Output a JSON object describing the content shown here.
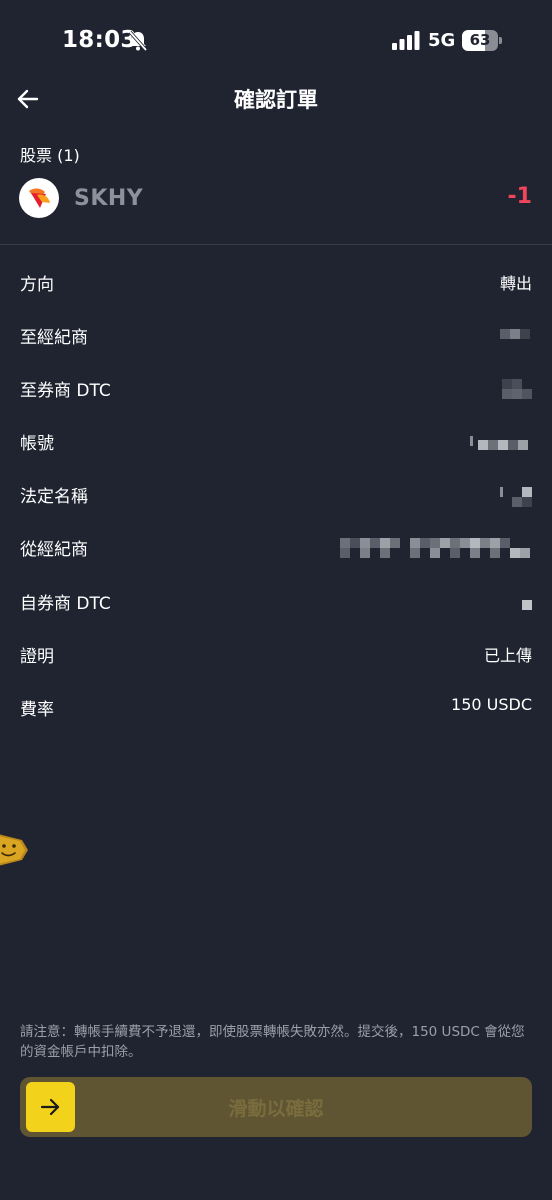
{
  "status_bar": {
    "time": "18:03",
    "network": "5G",
    "battery_percent": "63",
    "battery_level": 0.63
  },
  "header": {
    "title": "確認訂單"
  },
  "stocks": {
    "label": "股票 (1)",
    "items": [
      {
        "ticker": "SKHY",
        "quantity": "-1"
      }
    ]
  },
  "details": [
    {
      "label": "方向",
      "value": "轉出"
    },
    {
      "label": "至經紀商",
      "value": ""
    },
    {
      "label": "至券商 DTC",
      "value": ""
    },
    {
      "label": "帳號",
      "value": ""
    },
    {
      "label": "法定名稱",
      "value": ""
    },
    {
      "label": "從經紀商",
      "value": ""
    },
    {
      "label": "自券商 DTC",
      "value": ""
    },
    {
      "label": "證明",
      "value": "已上傳"
    },
    {
      "label": "費率",
      "value": "150 USDC"
    }
  ],
  "notice": "請注意：轉帳手續費不予退還，即使股票轉帳失敗亦然。提交後，150 USDC 會從您的資金帳戶中扣除。",
  "slider": {
    "label": "滑動以確認"
  },
  "colors": {
    "background": "#1f2430",
    "accent": "#f3d21c",
    "negative": "#f0455a",
    "muted_text": "#9a9ea8"
  }
}
